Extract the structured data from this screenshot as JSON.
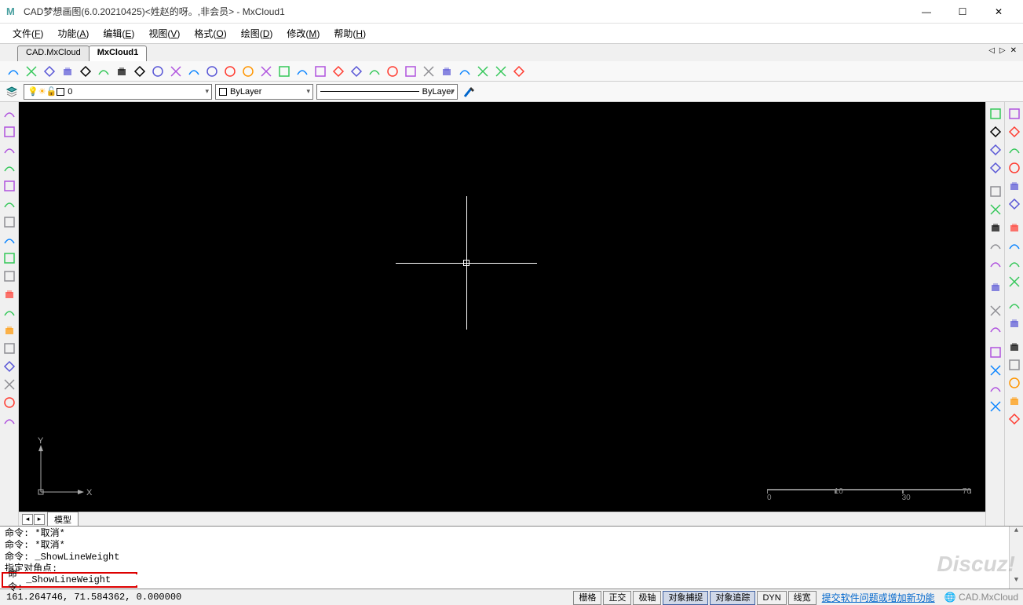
{
  "title": "CAD梦想画图(6.0.20210425)<姓赵的呀。,非会员> - MxCloud1",
  "app_icon_letter": "M",
  "menu": [
    {
      "label": "文件",
      "key": "F"
    },
    {
      "label": "功能",
      "key": "A"
    },
    {
      "label": "编辑",
      "key": "E"
    },
    {
      "label": "视图",
      "key": "V"
    },
    {
      "label": "格式",
      "key": "O"
    },
    {
      "label": "绘图",
      "key": "D"
    },
    {
      "label": "修改",
      "key": "M"
    },
    {
      "label": "帮助",
      "key": "H"
    }
  ],
  "tabs": [
    {
      "label": "CAD.MxCloud",
      "active": false
    },
    {
      "label": "MxCloud1",
      "active": true
    }
  ],
  "layer_bar": {
    "layer_name": "0",
    "color_label": "ByLayer",
    "linetype_label": "ByLayer"
  },
  "model_tab": "模型",
  "scale": {
    "ticks": [
      "0",
      "10",
      "30",
      "70"
    ]
  },
  "ucs": {
    "x": "X",
    "y": "Y"
  },
  "command_history": [
    "命令:  *取消*",
    "命令:  *取消*",
    "命令:  _ShowLineWeight",
    "指定对角点:"
  ],
  "command_prompt": "命令:",
  "command_input": "_ShowLineWeight",
  "status": {
    "coords": "161.264746,  71.584362,  0.000000",
    "buttons": [
      {
        "label": "栅格",
        "active": false
      },
      {
        "label": "正交",
        "active": false
      },
      {
        "label": "极轴",
        "active": false
      },
      {
        "label": "对象捕捉",
        "active": true
      },
      {
        "label": "对象追踪",
        "active": true
      },
      {
        "label": "DYN",
        "active": false
      },
      {
        "label": "线宽",
        "active": false
      }
    ],
    "link": "提交软件问题或增加新功能",
    "brand": "CAD.MxCloud"
  },
  "watermark": "Discuz!",
  "toolbar1_icons": [
    "new",
    "open",
    "import",
    "save",
    "saveas",
    "zoom-win",
    "zoom-in",
    "zoom-ext",
    "pan",
    "measure-angle",
    "dim",
    "zoom-realtime",
    "zoom",
    "target",
    "eraser",
    "layers",
    "hatch",
    "lineweight",
    "paste",
    "block",
    "attrib",
    "image",
    "undo",
    "redo",
    "print",
    "browser",
    "world",
    "pdf",
    "palette"
  ],
  "left_tools": [
    "line",
    "xline",
    "pline",
    "polygon",
    "rect",
    "arc",
    "circle-opt",
    "circle",
    "revcloud",
    "ellipse",
    "ellipse-arc",
    "donut",
    "spline",
    "block-ins",
    "text",
    "table",
    "vtext",
    "region"
  ],
  "right_tools_a": [
    "pan-rt",
    "copy-obj",
    "copy2",
    "paste-obj",
    "sep",
    "grid4",
    "mirror-h",
    "fillet-r",
    "arc-tan",
    "arc-tan2",
    "sep",
    "match",
    "sep",
    "folder",
    "hatch-ed",
    "sep",
    "dim-lin",
    "dim-align",
    "dim-ord",
    "dim-rad"
  ],
  "right_tools_b": [
    "highlight",
    "refresh",
    "plus",
    "rotate",
    "cube",
    "globe",
    "sep",
    "grid9",
    "mirror-v",
    "trim",
    "extend",
    "sep",
    "brush",
    "spark",
    "sep",
    "scissors",
    "hammer",
    "chain",
    "wrench",
    "tri"
  ]
}
